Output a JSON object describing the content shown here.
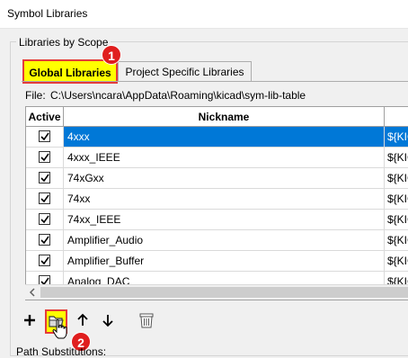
{
  "window": {
    "title": "Symbol Libraries"
  },
  "scope_group": {
    "label": "Libraries by Scope"
  },
  "tabs": [
    {
      "label": "Global Libraries",
      "selected": true
    },
    {
      "label": "Project Specific Libraries",
      "selected": false
    }
  ],
  "file": {
    "label": "File:",
    "path": "C:\\Users\\ncara\\AppData\\Roaming\\kicad\\sym-lib-table"
  },
  "grid": {
    "columns": [
      "Active",
      "Nickname",
      ""
    ],
    "rows": [
      {
        "active": true,
        "nickname": "4xxx",
        "uri": "${KIC",
        "selected": true
      },
      {
        "active": true,
        "nickname": "4xxx_IEEE",
        "uri": "${KIC",
        "selected": false
      },
      {
        "active": true,
        "nickname": "74xGxx",
        "uri": "${KIC",
        "selected": false
      },
      {
        "active": true,
        "nickname": "74xx",
        "uri": "${KIC",
        "selected": false
      },
      {
        "active": true,
        "nickname": "74xx_IEEE",
        "uri": "${KIC",
        "selected": false
      },
      {
        "active": true,
        "nickname": "Amplifier_Audio",
        "uri": "${KIC",
        "selected": false
      },
      {
        "active": true,
        "nickname": "Amplifier_Buffer",
        "uri": "${KIC",
        "selected": false
      },
      {
        "active": true,
        "nickname": "Analog_DAC",
        "uri": "${KIC",
        "selected": false
      }
    ]
  },
  "toolbar": {
    "add_icon": "plus-icon",
    "browse_icon": "folder-icon",
    "up_icon": "arrow-up-icon",
    "down_icon": "arrow-down-icon",
    "delete_icon": "trash-icon"
  },
  "callouts": {
    "one": "1",
    "two": "2"
  },
  "path_substitutions": {
    "label": "Path Substitutions:"
  },
  "colors": {
    "highlight": "#ffff00",
    "callout": "#e01e1e",
    "selection": "#0078d7"
  }
}
